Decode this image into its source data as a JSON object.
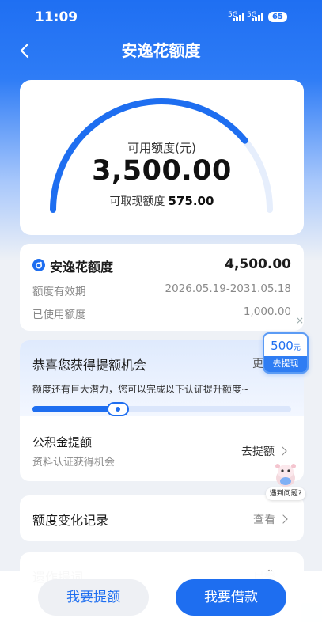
{
  "status_bar": {
    "time": "11:09",
    "network_1": "5G",
    "network_2": "5G",
    "battery": "65"
  },
  "nav": {
    "title": "安逸花额度"
  },
  "quota": {
    "available_label": "可用额度(元)",
    "available_amount": "3,500.00",
    "cash_label": "可取现额度",
    "cash_amount": "575.00",
    "gauge_used_fraction": 0.78
  },
  "product": {
    "name": "安逸花额度",
    "total": "4,500.00",
    "validity_label": "额度有效期",
    "validity_value": "2026.05.19-2031.05.18",
    "used_label": "已使用额度",
    "used_value": "1,000.00"
  },
  "increase": {
    "title": "恭喜您获得提额机会",
    "more_label": "更",
    "description": "额度还有巨大潜力，您可以完成以下认证提升额度~",
    "progress_fraction": 0.33,
    "fund_title": "公积金提额",
    "fund_subtitle": "资料认证获得机会",
    "fund_button": "去提额"
  },
  "records": {
    "title": "额度变化记录",
    "button": "查看"
  },
  "next_card": {
    "title": "遗作提词",
    "right": "已参"
  },
  "promo": {
    "amount": "500",
    "unit": "元",
    "cta": "去提现",
    "close": "×"
  },
  "help": {
    "label": "遇到问题?"
  },
  "bottom": {
    "left_button": "我要提额",
    "right_button": "我要借款"
  },
  "colors": {
    "brand": "#1e6ef0",
    "hero": "#1f6ff2"
  }
}
